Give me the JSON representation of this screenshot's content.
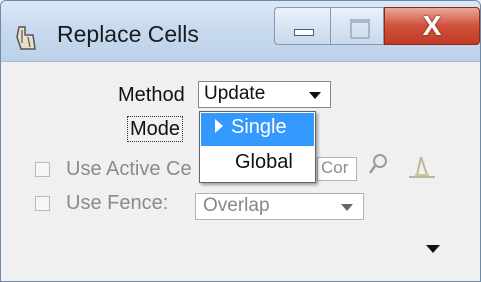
{
  "window": {
    "title": "Replace Cells",
    "icon": "cell-replace-icon",
    "buttons": {
      "minimize": "minimize-icon",
      "maximize": "maximize-icon",
      "close": "X"
    }
  },
  "form": {
    "method_label": "Method",
    "method_value": "Update",
    "mode_label": "Mode",
    "mode_options": [
      "Single",
      "Global"
    ],
    "mode_selected": "Single",
    "use_active_cell_label": "Use Active Ce",
    "use_active_cell_checked": false,
    "cell_name_value": "Cor",
    "use_fence_label": "Use Fence:",
    "use_fence_checked": false,
    "fence_mode_value": "Overlap"
  },
  "colors": {
    "selection": "#3399ff",
    "close_button": "#c8452f",
    "disabled_text": "#8b8b8b"
  }
}
